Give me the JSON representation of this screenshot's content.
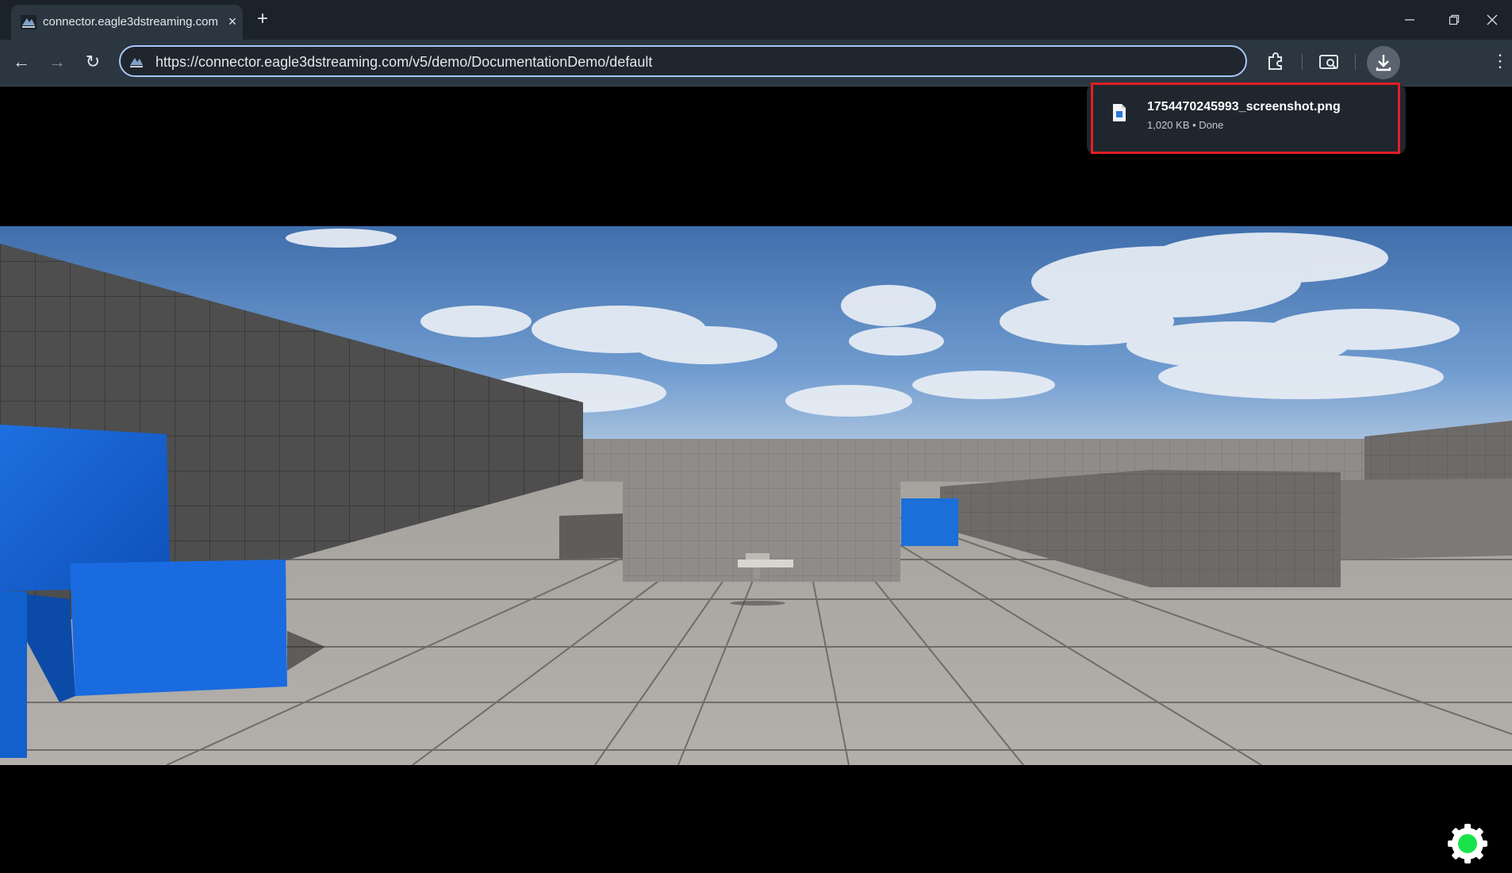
{
  "browser": {
    "tab": {
      "title": "connector.eagle3dstreaming.com",
      "favicon": "eagle-logo-icon",
      "close_icon": "×"
    },
    "new_tab_icon": "+",
    "window_controls": [
      "minimize-icon",
      "restore-icon",
      "close-icon"
    ],
    "toolbar": {
      "back_icon": "←",
      "forward_icon": "→",
      "reload_icon": "↻",
      "url": "https://connector.eagle3dstreaming.com/v5/demo/DocumentationDemo/default",
      "menu_icon": "⋮"
    }
  },
  "download_bubble": {
    "filename": "1754470245993_screenshot.png",
    "status": "1,020 KB • Done",
    "highlight_color": "#e41e26"
  },
  "stream": {
    "scene": "3D level: grid-textured walls and floor, blue cubes, weapon on floor, cloudy sky"
  },
  "settings": {
    "icon": "gear-icon",
    "status_color": "#19e34a"
  }
}
